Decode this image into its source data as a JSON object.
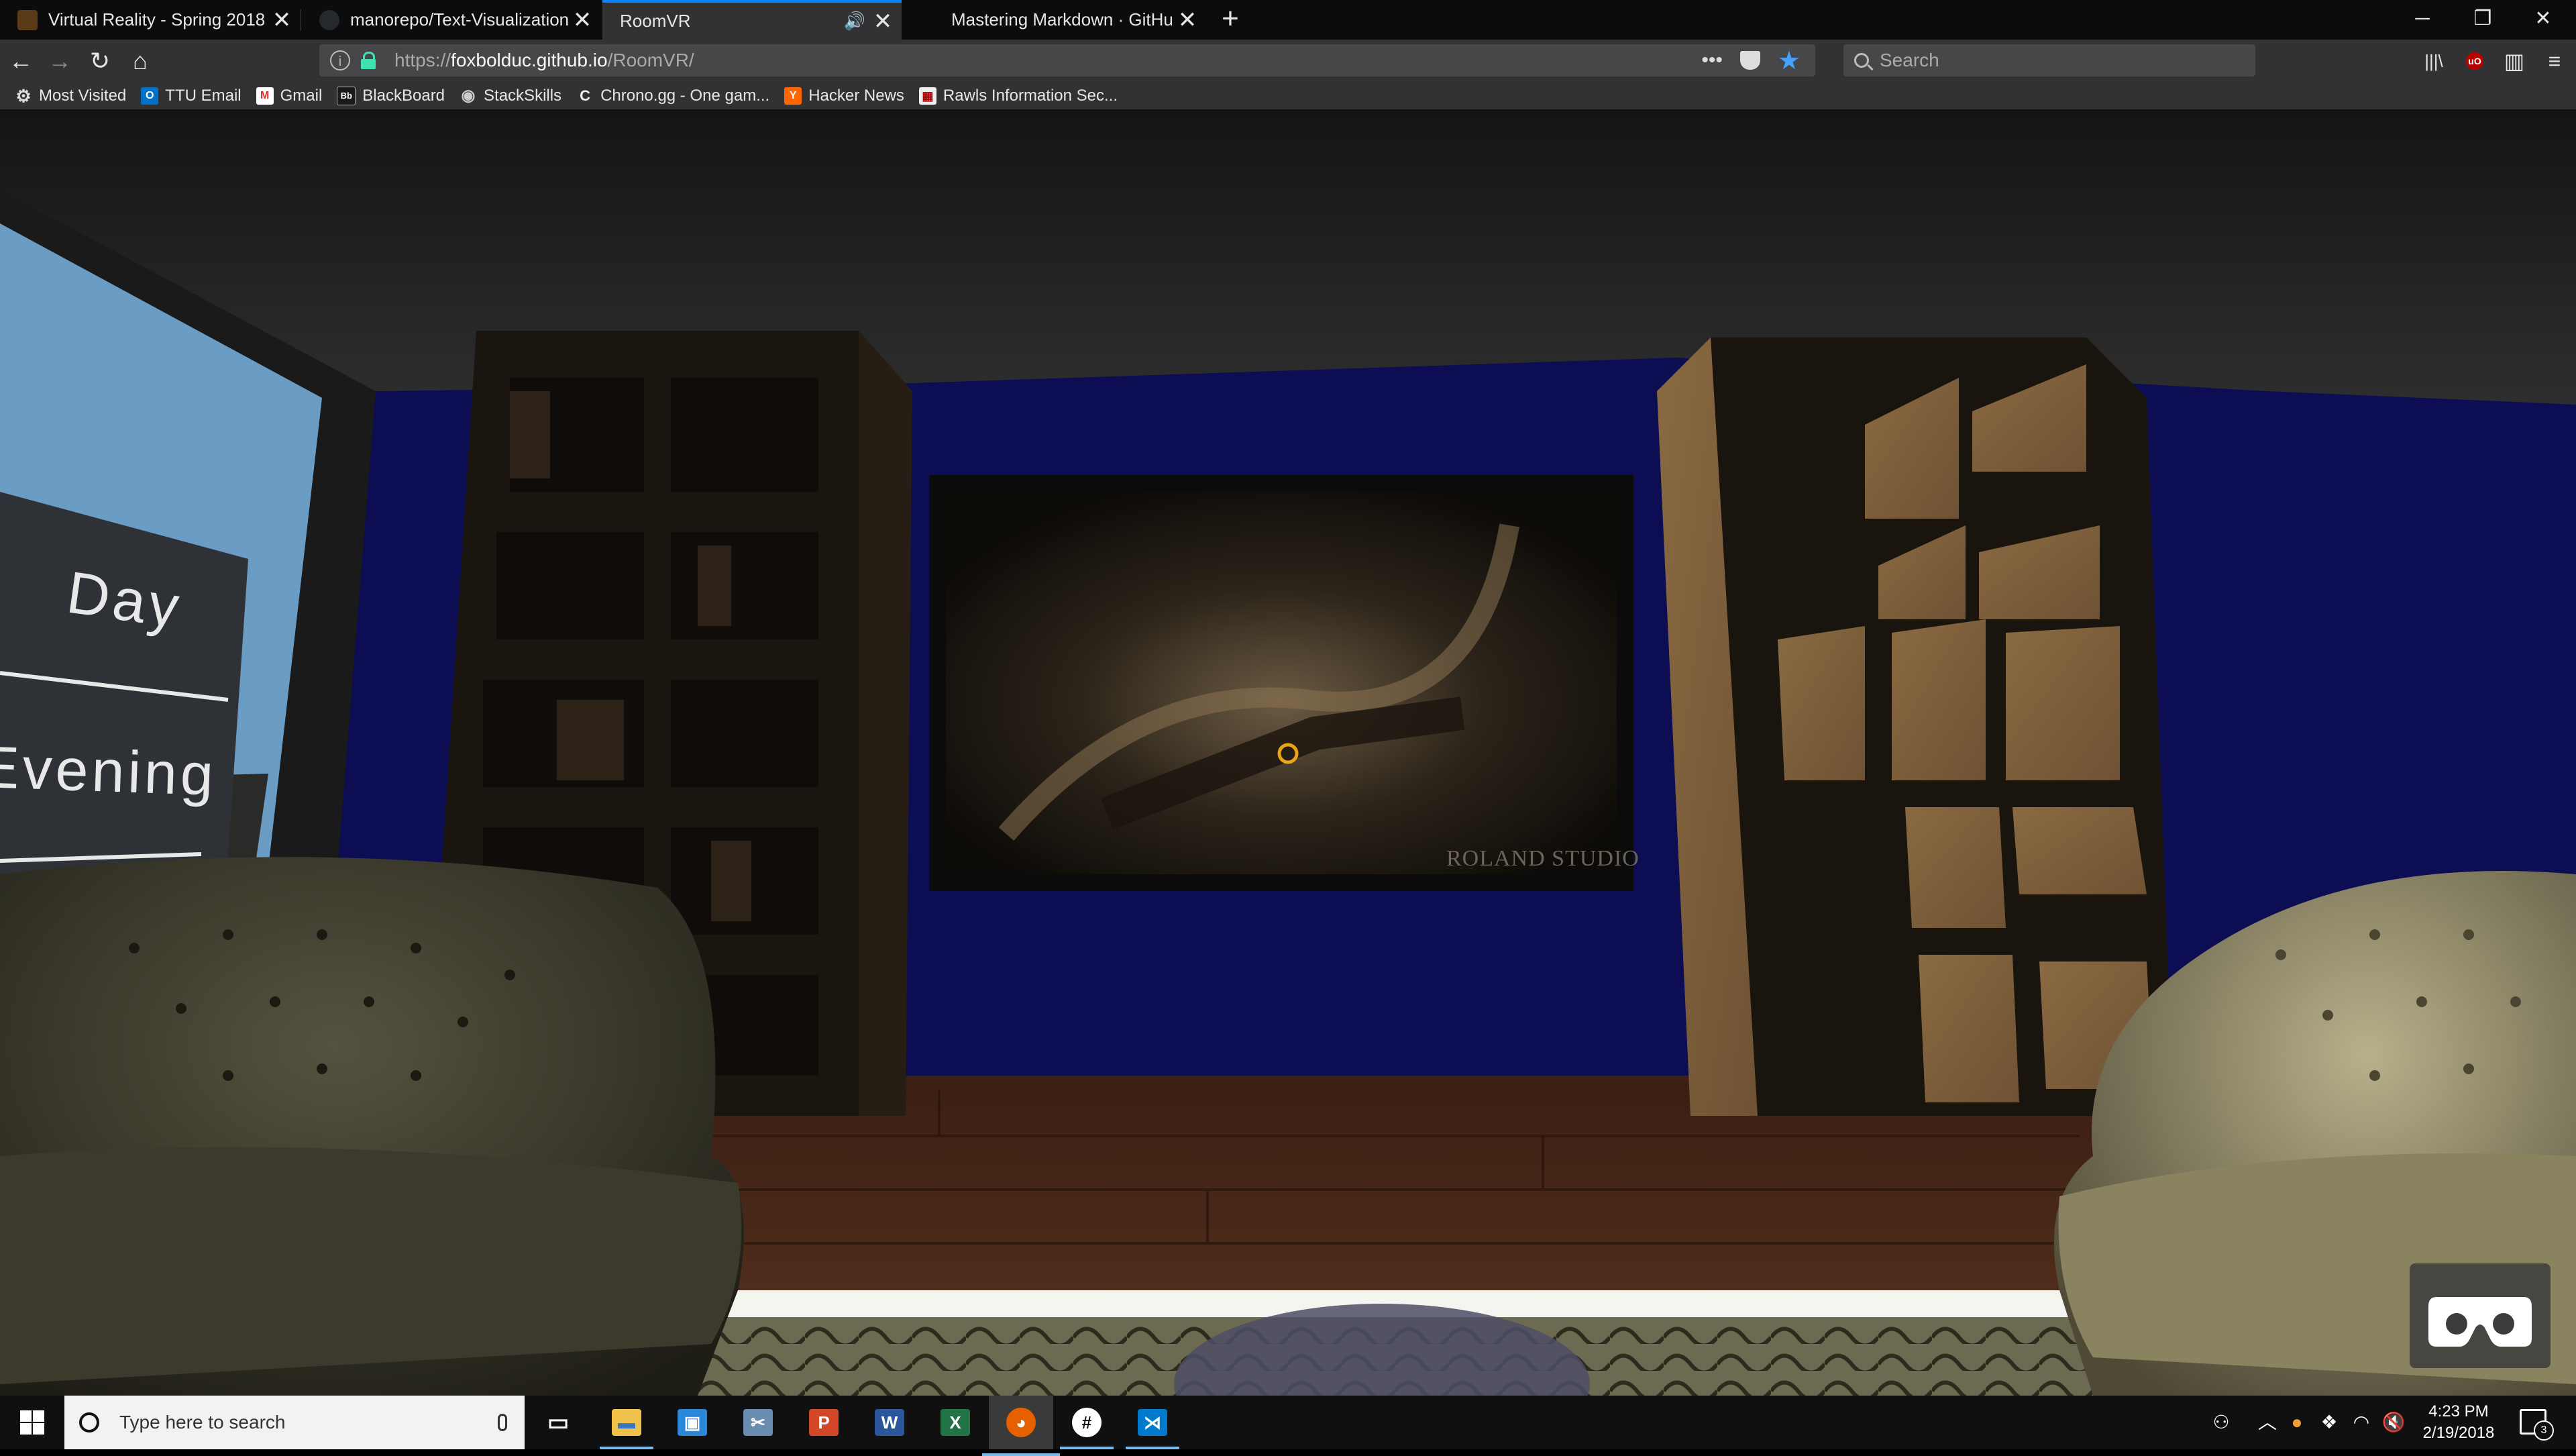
{
  "tabs": [
    {
      "title": "Virtual Reality - Spring 2018",
      "favicon_color": "#5b3a1a"
    },
    {
      "title": "manorepo/Text-Visualization",
      "favicon_color": "#24292e"
    },
    {
      "title": "RoomVR",
      "favicon_color": "#323234",
      "active": true,
      "playing_audio": true
    },
    {
      "title": "Mastering Markdown · GitHub",
      "favicon_color": "#0c0c0d"
    }
  ],
  "window_controls": {
    "minimize": "─",
    "restore": "❐",
    "close": "✕"
  },
  "tab_close_glyph": "✕",
  "new_tab_glyph": "+",
  "nav": {
    "back": "←",
    "forward": "→",
    "reload": "↻",
    "home": "⌂"
  },
  "url": {
    "prefix": "https://",
    "domain": "foxbolduc.github.io",
    "path": "/RoomVR/"
  },
  "url_actions": {
    "more": "•••"
  },
  "search": {
    "placeholder": "Search"
  },
  "toolbar": {
    "library": "|||\\",
    "ublock": "uO",
    "sidebar": "▥",
    "menu": "≡"
  },
  "bookmarks": [
    {
      "label": "Most Visited",
      "icon": "gear-icon",
      "color": "#323234",
      "glyph": "⚙"
    },
    {
      "label": "TTU Email",
      "icon": "outlook-icon",
      "color": "#0072c6",
      "glyph": "O"
    },
    {
      "label": "Gmail",
      "icon": "gmail-icon",
      "color": "#d93025",
      "glyph": "M"
    },
    {
      "label": "BlackBoard",
      "icon": "blackboard-icon",
      "color": "#1a1a1a",
      "glyph": "Bb"
    },
    {
      "label": "StackSkills",
      "icon": "stackskills-icon",
      "color": "#555",
      "glyph": "◉"
    },
    {
      "label": "Chrono.gg - One gam...",
      "icon": "chrono-icon",
      "color": "#323234",
      "glyph": "C"
    },
    {
      "label": "Hacker News",
      "icon": "hackernews-icon",
      "color": "#ff6600",
      "glyph": "Y"
    },
    {
      "label": "Rawls Information Sec...",
      "icon": "rawls-icon",
      "color": "#eeeeee",
      "glyph": "▦"
    }
  ],
  "scene": {
    "menu_day": "Day",
    "menu_evening": "Evening",
    "tv_watermark": "ROLAND STUDIO",
    "gaze_cursor_color": "#e8a317"
  },
  "taskbar": {
    "search_placeholder": "Type here to search",
    "apps": [
      {
        "name": "task-view",
        "color": "#101010",
        "glyph": "▭"
      },
      {
        "name": "file-explorer",
        "color": "#f0c14b",
        "glyph": "▬"
      },
      {
        "name": "remote-desktop",
        "color": "#2b88d8",
        "glyph": "▣"
      },
      {
        "name": "snipping-tool",
        "color": "#6a8caf",
        "glyph": "✂"
      },
      {
        "name": "powerpoint",
        "color": "#d24726",
        "glyph": "P"
      },
      {
        "name": "word",
        "color": "#2b579a",
        "glyph": "W"
      },
      {
        "name": "excel",
        "color": "#217346",
        "glyph": "X"
      },
      {
        "name": "firefox",
        "color": "#e66000",
        "glyph": "◕"
      },
      {
        "name": "slack",
        "color": "#ffffff",
        "glyph": "#"
      },
      {
        "name": "vscode",
        "color": "#007acc",
        "glyph": "⋊"
      }
    ],
    "time": "4:23 PM",
    "date": "2/19/2018",
    "notification_count": "3"
  }
}
